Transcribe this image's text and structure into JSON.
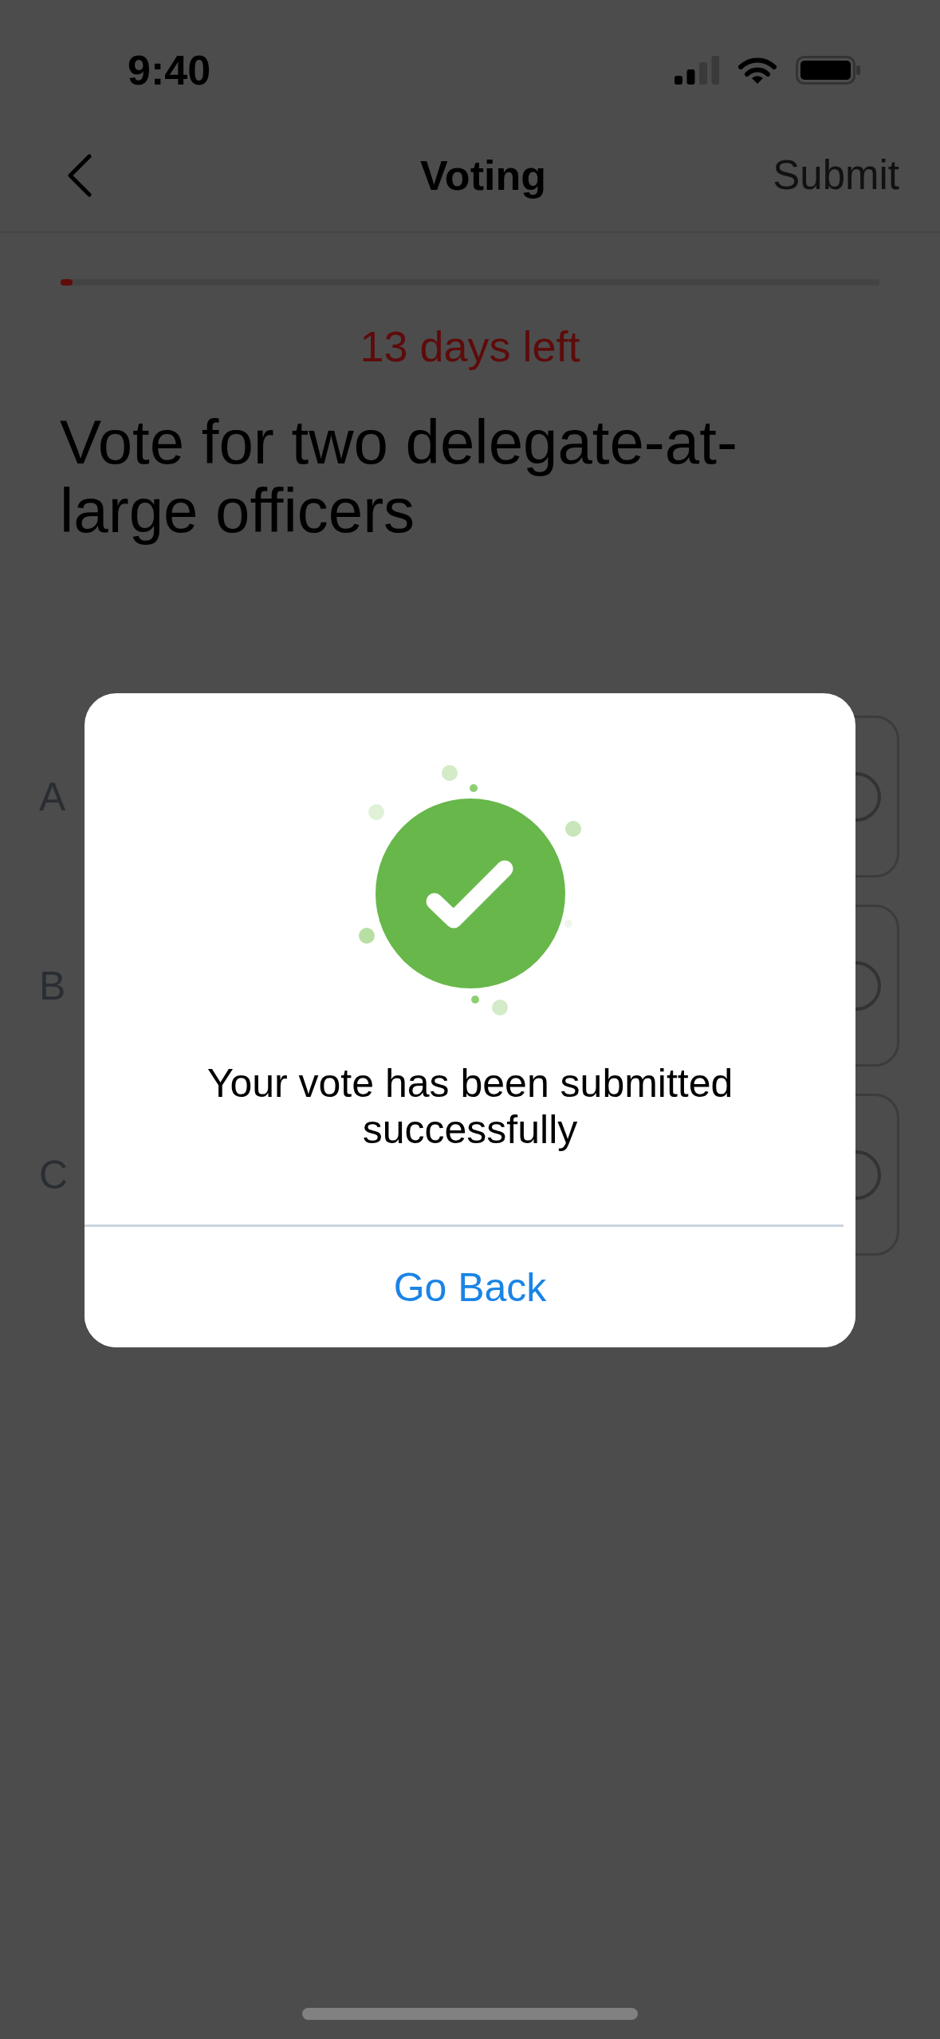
{
  "status_bar": {
    "time": "9:40"
  },
  "nav_bar": {
    "title": "Voting",
    "action": "Submit"
  },
  "progress": {
    "level": 0.015,
    "label": "13 days left"
  },
  "question": "Vote for two delegate-at-large officers",
  "options": [
    {
      "label": "A",
      "selected": false
    },
    {
      "label": "B",
      "selected": false
    },
    {
      "label": "C",
      "selected": false
    }
  ],
  "dialog": {
    "message": "Your vote has been submitted successfully",
    "button": "Go Back"
  }
}
